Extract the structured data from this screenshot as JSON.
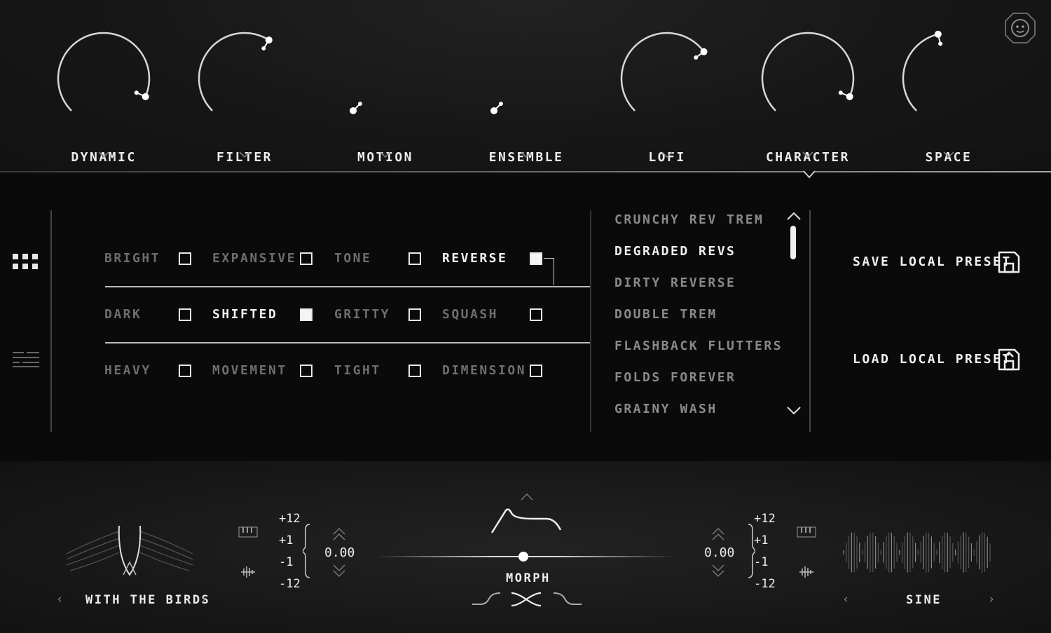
{
  "knobs": [
    {
      "label": "DYNAMIC",
      "value": 0.92
    },
    {
      "label": "FILTER",
      "value": 0.62
    },
    {
      "label": "MOTION",
      "value": 0.0
    },
    {
      "label": "ENSEMBLE",
      "value": 0.0
    },
    {
      "label": "LOFI",
      "value": 0.7
    },
    {
      "label": "CHARACTER",
      "value": 0.92
    },
    {
      "label": "SPACE",
      "value": 0.45
    }
  ],
  "tags": {
    "rows": [
      [
        {
          "label": "BRIGHT",
          "checked": false
        },
        {
          "label": "EXPANSIVE",
          "checked": false
        },
        {
          "label": "TONE",
          "checked": false
        },
        {
          "label": "REVERSE",
          "checked": true
        }
      ],
      [
        {
          "label": "DARK",
          "checked": false
        },
        {
          "label": "SHIFTED",
          "checked": true
        },
        {
          "label": "GRITTY",
          "checked": false
        },
        {
          "label": "SQUASH",
          "checked": false
        }
      ],
      [
        {
          "label": "HEAVY",
          "checked": false
        },
        {
          "label": "MOVEMENT",
          "checked": false
        },
        {
          "label": "TIGHT",
          "checked": false
        },
        {
          "label": "DIMENSION",
          "checked": false
        }
      ]
    ]
  },
  "presets": {
    "items": [
      "CRUNCHY REV TREM",
      "DEGRADED REVS",
      "DIRTY REVERSE",
      "DOUBLE TREM",
      "FLASHBACK FLUTTERS",
      "FOLDS FOREVER",
      "GRAINY WASH"
    ],
    "selected_index": 1
  },
  "actions": {
    "save_label": "SAVE LOCAL PRESET",
    "load_label": "LOAD LOCAL PRESET"
  },
  "left_source": {
    "name": "WITH THE BIRDS",
    "pitch_labels": [
      "+12",
      "+1",
      "-1",
      "-12"
    ],
    "pitch_value": "0.00"
  },
  "morph": {
    "label": "MORPH",
    "value": 0.5
  },
  "right_source": {
    "name": "SINE",
    "pitch_labels": [
      "+12",
      "+1",
      "-1",
      "-12"
    ],
    "pitch_value": "0.00"
  },
  "colors": {
    "background": "#0b0b0b",
    "panel": "#171717",
    "text_active": "#f2f2f2",
    "text_inactive": "#6e6e6e",
    "accent": "#ffffff"
  }
}
